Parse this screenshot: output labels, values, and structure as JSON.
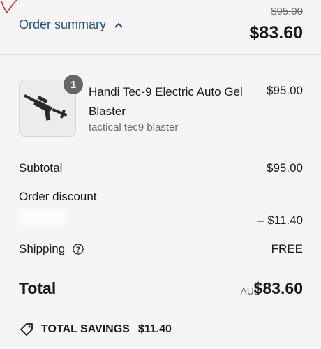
{
  "header": {
    "toggle_label": "Order summary",
    "original_price": "$95.00",
    "total_price": "$83.60"
  },
  "product": {
    "name": "Handi Tec-9 Electric Auto Gel Blaster",
    "variant": "tactical tec9 blaster",
    "price": "$95.00",
    "quantity": "1"
  },
  "summary": {
    "subtotal_label": "Subtotal",
    "subtotal_value": "$95.00",
    "discount_label": "Order discount",
    "discount_value": "– $11.40",
    "shipping_label": "Shipping",
    "shipping_value": "FREE"
  },
  "total": {
    "label": "Total",
    "currency": "AUD",
    "value": "$83.60"
  },
  "savings": {
    "label": "TOTAL SAVINGS",
    "value": "$11.40"
  },
  "colors": {
    "link": "#1f4f7a",
    "badge": "#666666",
    "background": "#f5f5f5"
  },
  "icons": [
    "chevron-up-icon",
    "help-circle-icon",
    "price-tag-icon"
  ]
}
